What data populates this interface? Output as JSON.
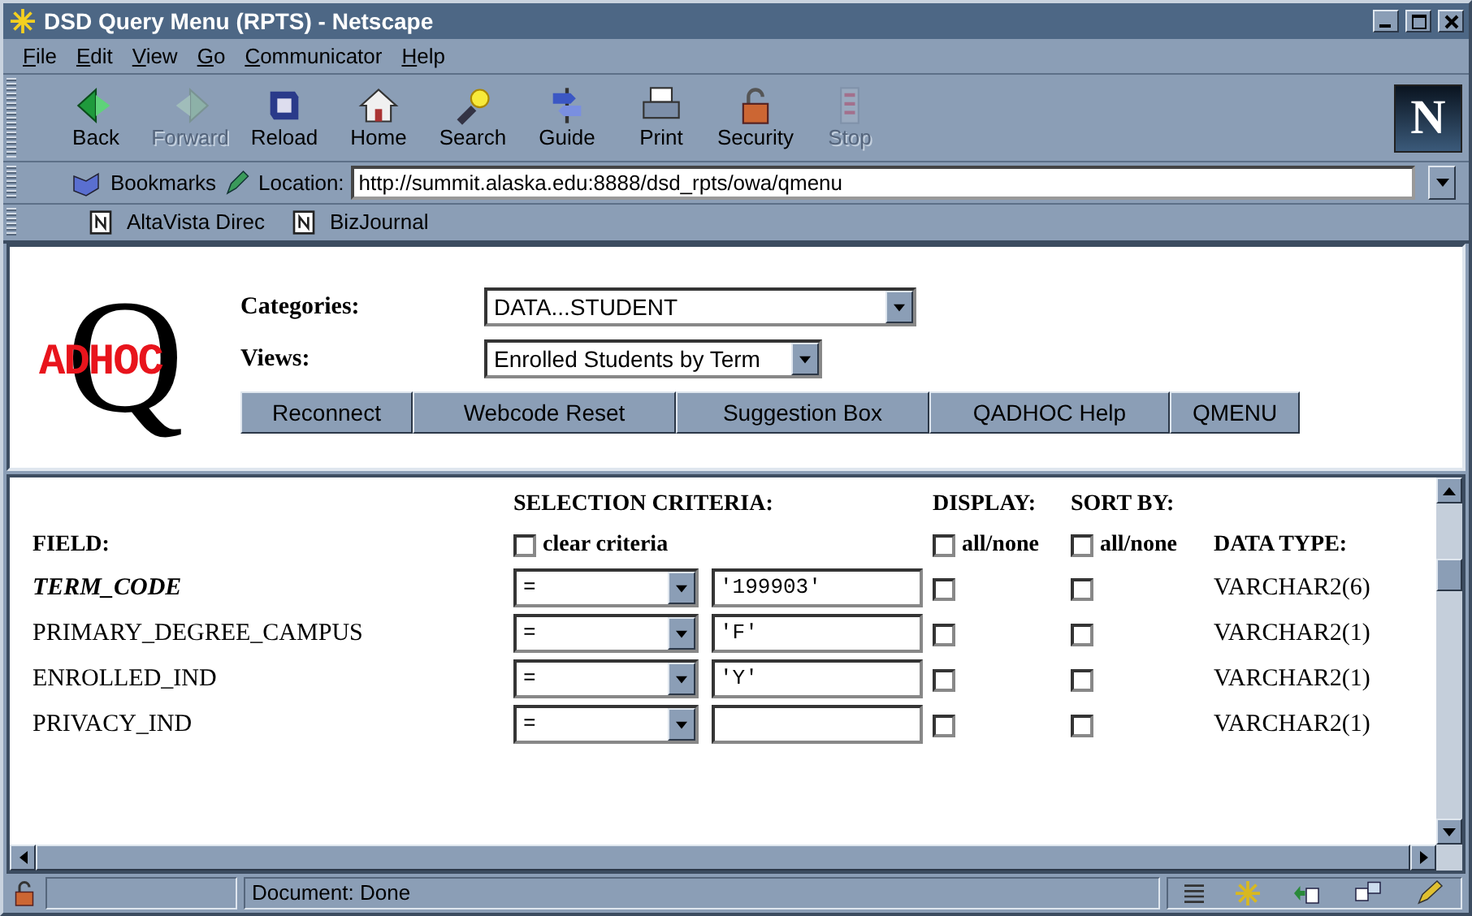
{
  "window": {
    "title": "DSD Query Menu (RPTS) - Netscape"
  },
  "menu": [
    "File",
    "Edit",
    "View",
    "Go",
    "Communicator",
    "Help"
  ],
  "toolbar": [
    {
      "label": "Back",
      "disabled": false
    },
    {
      "label": "Forward",
      "disabled": true
    },
    {
      "label": "Reload",
      "disabled": false
    },
    {
      "label": "Home",
      "disabled": false
    },
    {
      "label": "Search",
      "disabled": false
    },
    {
      "label": "Guide",
      "disabled": false
    },
    {
      "label": "Print",
      "disabled": false
    },
    {
      "label": "Security",
      "disabled": false
    },
    {
      "label": "Stop",
      "disabled": true
    }
  ],
  "brand_mark": "N",
  "location_bar": {
    "bookmarks": "Bookmarks",
    "label": "Location:",
    "url": "http://summit.alaska.edu:8888/dsd_rpts/owa/qmenu"
  },
  "personal_toolbar": [
    "AltaVista Direc",
    "BizJournal"
  ],
  "logo": {
    "letter": "Q",
    "word": "ADHOC"
  },
  "categories": {
    "label": "Categories:",
    "value": "DATA...STUDENT"
  },
  "views": {
    "label": "Views:",
    "value": "Enrolled Students by Term"
  },
  "nav_buttons": [
    "Reconnect",
    "Webcode Reset",
    "Suggestion Box",
    "QADHOC Help",
    "QMENU"
  ],
  "criteria_table": {
    "headers": {
      "field": "FIELD:",
      "selection": "SELECTION CRITERIA:",
      "clear": "clear criteria",
      "clear_checked": false,
      "display": "DISPLAY:",
      "display_all": "all/none",
      "display_all_checked": false,
      "sort": "SORT BY:",
      "sort_all": "all/none",
      "sort_all_checked": false,
      "data_type": "DATA TYPE:"
    },
    "rows": [
      {
        "field": "TERM_CODE",
        "emphasized": true,
        "operator": "=",
        "value": "'199903'",
        "display": false,
        "sort": false,
        "data_type": "VARCHAR2(6)"
      },
      {
        "field": "PRIMARY_DEGREE_CAMPUS",
        "emphasized": false,
        "operator": "=",
        "value": "'F'",
        "display": false,
        "sort": false,
        "data_type": "VARCHAR2(1)"
      },
      {
        "field": "ENROLLED_IND",
        "emphasized": false,
        "operator": "=",
        "value": "'Y'",
        "display": false,
        "sort": false,
        "data_type": "VARCHAR2(1)"
      },
      {
        "field": "PRIVACY_IND",
        "emphasized": false,
        "operator": "=",
        "value": "",
        "display": false,
        "sort": false,
        "data_type": "VARCHAR2(1)"
      }
    ]
  },
  "status_bar": {
    "text": "Document: Done"
  }
}
